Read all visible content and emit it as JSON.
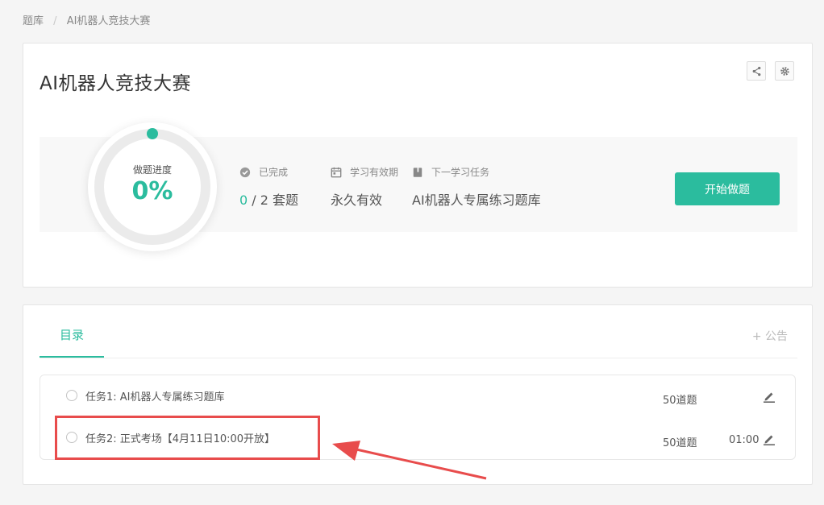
{
  "breadcrumb": {
    "root": "题库",
    "separator": "/",
    "current": "AI机器人竞技大赛"
  },
  "header": {
    "title": "AI机器人竞技大赛",
    "share_icon": "share-icon",
    "settings_icon": "gear-icon"
  },
  "progress": {
    "label": "做题进度",
    "value_text": "0%",
    "value": 0,
    "accent_color": "#2bbc9e"
  },
  "stats": {
    "completed": {
      "label": "已完成",
      "done": "0",
      "rest": " / 2 套题",
      "icon": "check-circle-icon"
    },
    "validity": {
      "label": "学习有效期",
      "value": "永久有效",
      "icon": "calendar-icon"
    },
    "next_task": {
      "label": "下一学习任务",
      "value": "AI机器人专属练习题库",
      "icon": "book-icon"
    }
  },
  "start_button": {
    "label": "开始做题"
  },
  "tabs": {
    "active": "目录",
    "notice": "+ 公告"
  },
  "tasks": [
    {
      "name": "任务1:  AI机器人专属练习题库",
      "count": "50道题",
      "time": ""
    },
    {
      "name": "任务2:  正式考场【4月11日10:00开放】",
      "count": "50道题",
      "time": "01:00"
    }
  ],
  "annotation": {
    "highlight_color": "#e84c4c"
  }
}
